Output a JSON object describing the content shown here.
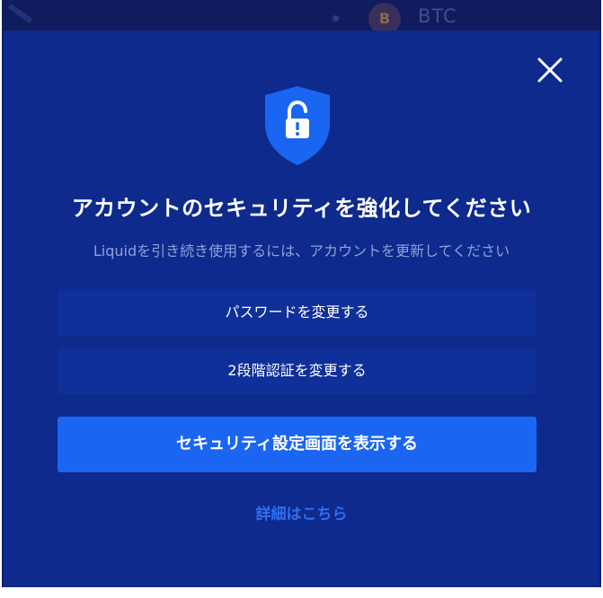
{
  "background": {
    "ticker": "BTC",
    "coin_symbol": "B"
  },
  "modal": {
    "title": "アカウントのセキュリティを強化してください",
    "subtitle": "Liquidを引き続き使用するには、アカウントを更新してください",
    "buttons": {
      "change_password": "パスワードを変更する",
      "change_2fa": "2段階認証を変更する",
      "security_settings": "セキュリティ設定画面を表示する"
    },
    "details_link": "詳細はこちら",
    "icons": {
      "close": "close-icon",
      "shield": "shield-lock-icon"
    }
  },
  "colors": {
    "modal_background": "#0d2a8c",
    "primary_button": "#1a66f2",
    "secondary_button": "#0f2f99",
    "shield": "#1a66f2",
    "link": "#2f6ff0",
    "subtitle": "#8fa1d8"
  }
}
